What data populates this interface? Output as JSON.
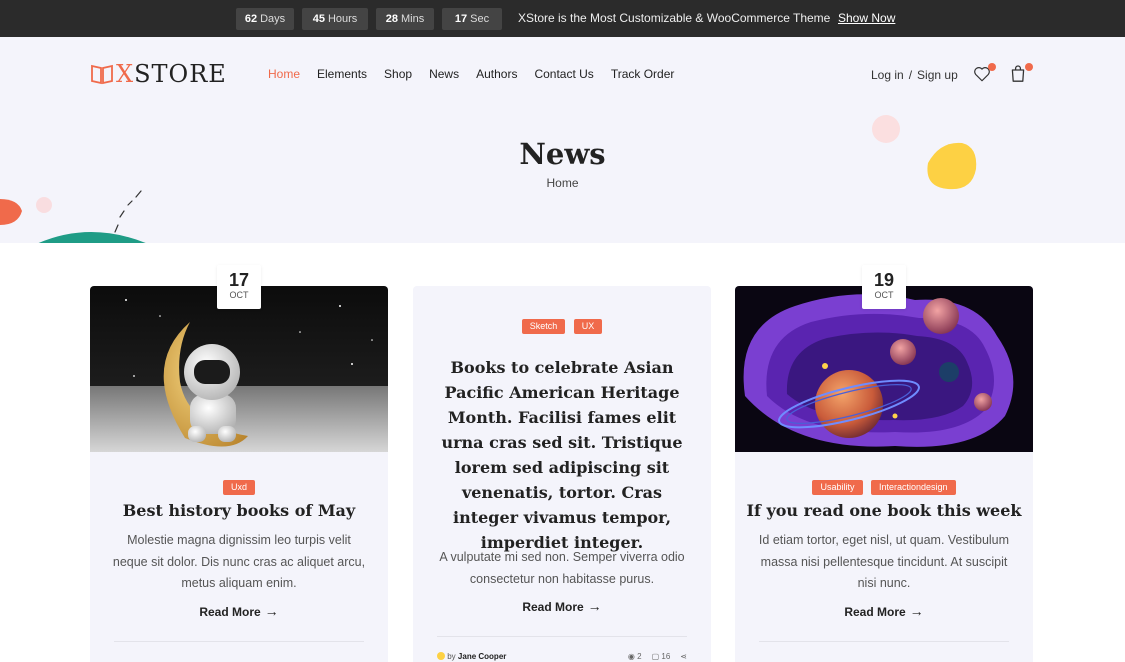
{
  "countdown": {
    "days": {
      "value": "62",
      "unit": "Days"
    },
    "hours": {
      "value": "45",
      "unit": "Hours"
    },
    "mins": {
      "value": "28",
      "unit": "Mins"
    },
    "secs": {
      "value": "17",
      "unit": "Sec"
    }
  },
  "promo": {
    "text": "XStore is the Most Customizable & WooCommerce Theme",
    "link": "Show Now"
  },
  "logo": {
    "accent": "X",
    "rest": "STORE"
  },
  "nav": [
    "Home",
    "Elements",
    "Shop",
    "News",
    "Authors",
    "Contact Us",
    "Track Order"
  ],
  "account": {
    "login": "Log in",
    "separator": "/",
    "signup": "Sign up"
  },
  "icons": {
    "wishlist": "heart-icon",
    "cart": "shopping-bag-icon",
    "arrow": "arrow-right-icon"
  },
  "hero": {
    "title": "News",
    "breadcrumb": "Home"
  },
  "colors": {
    "accent": "#f06a4b",
    "hero_bg": "#f4f4fb",
    "topbar_bg": "#2b2b2b",
    "yellow": "#fdd144",
    "teal": "#1f9c86"
  },
  "posts": [
    {
      "day": "17",
      "month": "OCT",
      "tags": [
        "Uxd"
      ],
      "title": "Best history books of May",
      "excerpt": "Molestie magna dignissim leo turpis velit neque sit dolor. Dis nunc cras ac aliquet arcu, metus aliquam enim.",
      "read_more": "Read More"
    },
    {
      "tags": [
        "Sketch",
        "UX"
      ],
      "title": "Books to celebrate Asian Pacific American Heritage Month. Facilisi fames elit urna cras sed sit. Tristique lorem sed adipiscing sit venenatis, tortor. Cras integer vivamus tempor, imperdiet integer.",
      "excerpt": "A vulputate mi sed non. Semper viverra odio consectetur non habitasse purus.",
      "read_more": "Read More",
      "author_prefix": "by",
      "author": "Jane Cooper",
      "views": "2",
      "comments": "16"
    },
    {
      "day": "19",
      "month": "OCT",
      "tags": [
        "Usability",
        "Interactiondesign"
      ],
      "title": "If you read one book this week",
      "excerpt": "Id etiam tortor, eget nisl, ut quam. Vestibulum massa nisi pellentesque tincidunt. At suscipit nisi nunc.",
      "read_more": "Read More"
    }
  ]
}
